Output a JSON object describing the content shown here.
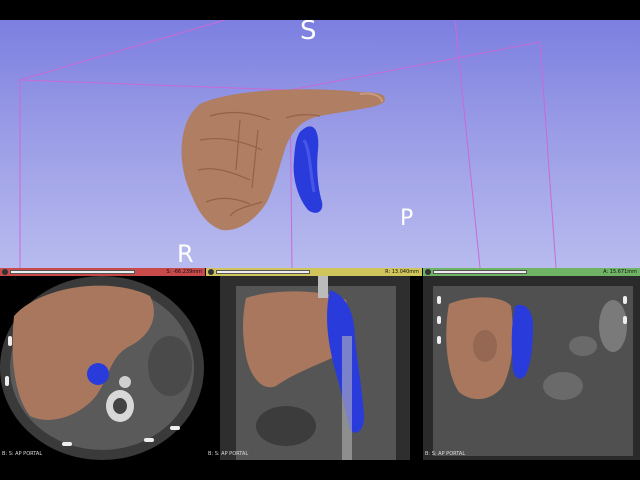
{
  "view3d": {
    "orientation": {
      "superior": "S",
      "posterior": "P",
      "right": "R"
    },
    "colors": {
      "liver": "#b07e62",
      "vessel": "#2a3bdc",
      "box": "#c36ad8"
    }
  },
  "slices": {
    "red": {
      "offset": "S: -66.239mm",
      "label": "B: S: AP PORTAL",
      "color": "#c94a4a"
    },
    "yellow": {
      "offset": "R: 13.040mm",
      "label": "B: S: AP PORTAL",
      "color": "#cfc55a"
    },
    "green": {
      "offset": "A: 15.671mm",
      "label": "B: S: AP PORTAL",
      "color": "#6fb365"
    }
  }
}
